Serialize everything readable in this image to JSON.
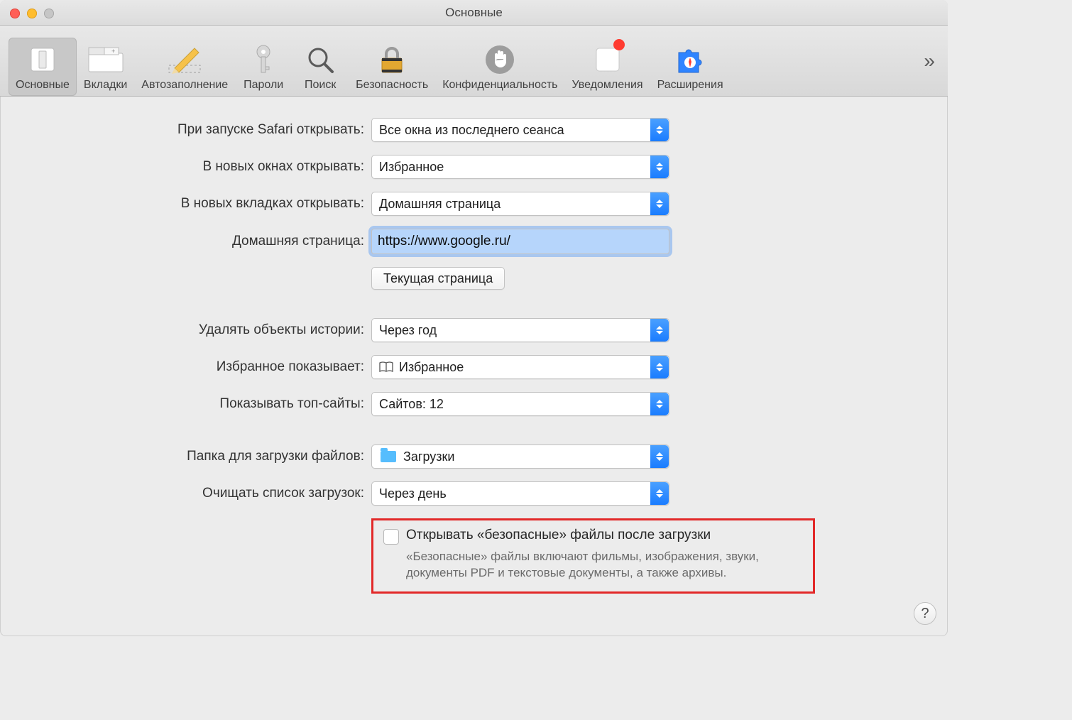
{
  "window": {
    "title": "Основные"
  },
  "toolbar": {
    "tabs": [
      {
        "id": "general",
        "label": "Основные",
        "selected": true
      },
      {
        "id": "tabs",
        "label": "Вкладки"
      },
      {
        "id": "autofill",
        "label": "Автозаполнение"
      },
      {
        "id": "passwords",
        "label": "Пароли"
      },
      {
        "id": "search",
        "label": "Поиск"
      },
      {
        "id": "security",
        "label": "Безопасность"
      },
      {
        "id": "privacy",
        "label": "Конфиденциальность"
      },
      {
        "id": "notifications",
        "label": "Уведомления",
        "badge": true
      },
      {
        "id": "extensions",
        "label": "Расширения"
      }
    ],
    "overflow_glyph": "»"
  },
  "form": {
    "on_launch_label": "При запуске Safari открывать:",
    "on_launch_value": "Все окна из последнего сеанса",
    "new_windows_label": "В новых окнах открывать:",
    "new_windows_value": "Избранное",
    "new_tabs_label": "В новых вкладках открывать:",
    "new_tabs_value": "Домашняя страница",
    "homepage_label": "Домашняя страница:",
    "homepage_value": "https://www.google.ru/",
    "current_page_button": "Текущая страница",
    "remove_history_label": "Удалять объекты истории:",
    "remove_history_value": "Через год",
    "favorites_shows_label": "Избранное показывает:",
    "favorites_shows_value": "Избранное",
    "top_sites_label": "Показывать топ-сайты:",
    "top_sites_value": "Сайтов: 12",
    "download_folder_label": "Папка для загрузки файлов:",
    "download_folder_value": "Загрузки",
    "clear_downloads_label": "Очищать список загрузок:",
    "clear_downloads_value": "Через день",
    "safe_files_checkbox": "Открывать «безопасные» файлы после загрузки",
    "safe_files_desc": "«Безопасные» файлы включают фильмы, изображения, звуки, документы PDF и текстовые документы, а также архивы."
  },
  "help_glyph": "?"
}
